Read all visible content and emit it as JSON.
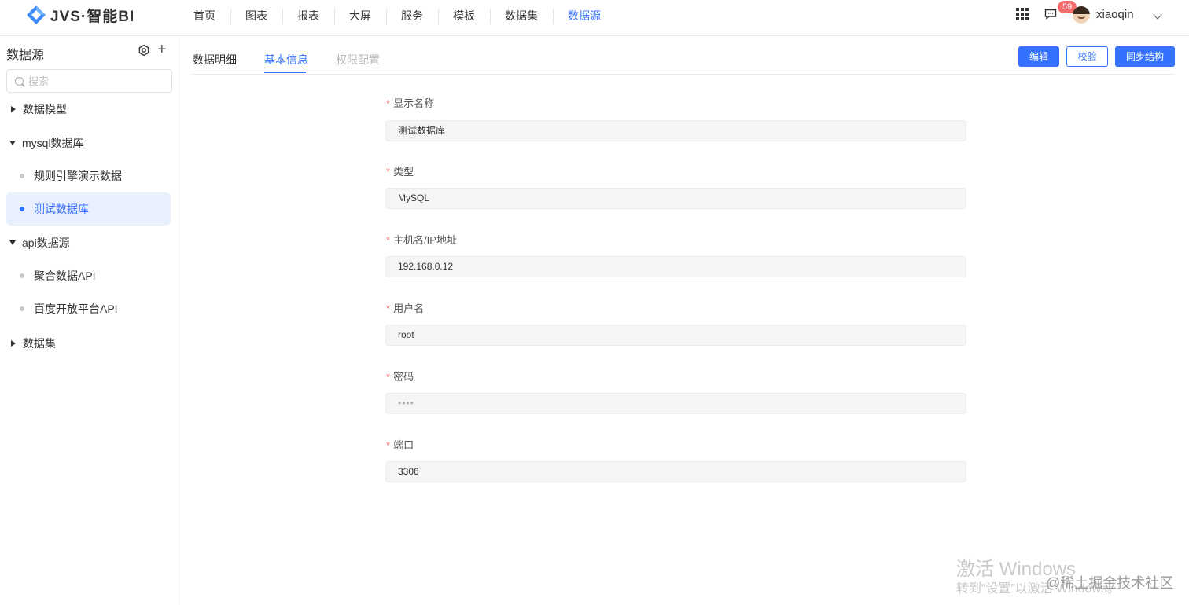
{
  "app": {
    "logo_text": "JVS·智能BI"
  },
  "nav": {
    "items": [
      {
        "label": "首页"
      },
      {
        "label": "图表"
      },
      {
        "label": "报表"
      },
      {
        "label": "大屏"
      },
      {
        "label": "服务"
      },
      {
        "label": "模板"
      },
      {
        "label": "数据集"
      },
      {
        "label": "数据源"
      }
    ],
    "active": "数据源"
  },
  "user": {
    "name": "xiaoqin",
    "message_count": "59"
  },
  "sidebar": {
    "title": "数据源",
    "search_placeholder": "搜索",
    "groups": [
      {
        "label": "数据模型",
        "expanded": false
      },
      {
        "label": "mysql数据库",
        "expanded": true
      },
      {
        "label": "api数据源",
        "expanded": true
      },
      {
        "label": "数据集",
        "expanded": false
      }
    ],
    "leaves": [
      {
        "label": "规则引擎演示数据",
        "active": false
      },
      {
        "label": "测试数据库",
        "active": true
      },
      {
        "label": "聚合数据API",
        "active": false
      },
      {
        "label": "百度开放平台API",
        "active": false
      }
    ]
  },
  "tabs": [
    {
      "label": "数据明细",
      "state": "normal"
    },
    {
      "label": "基本信息",
      "state": "active"
    },
    {
      "label": "权限配置",
      "state": "disabled"
    }
  ],
  "actions": {
    "edit": "编辑",
    "verify": "校验",
    "sync": "同步结构"
  },
  "form": {
    "required_mark": "*",
    "fields": [
      {
        "label": "显示名称",
        "value": "测试数据库"
      },
      {
        "label": "类型",
        "value": "MySQL"
      },
      {
        "label": "主机名/IP地址",
        "value": "192.168.0.12"
      },
      {
        "label": "用户名",
        "value": "root"
      },
      {
        "label": "密码",
        "value": "••••"
      },
      {
        "label": "端口",
        "value": "3306"
      }
    ]
  },
  "watermark": {
    "line1": "激活 Windows",
    "line2": "转到“设置”以激活 Windows。",
    "credit": "@稀土掘金技术社区"
  },
  "colors": {
    "accent": "#3471ff",
    "required": "#f56c6c",
    "active_bg": "#e9f0fd"
  }
}
